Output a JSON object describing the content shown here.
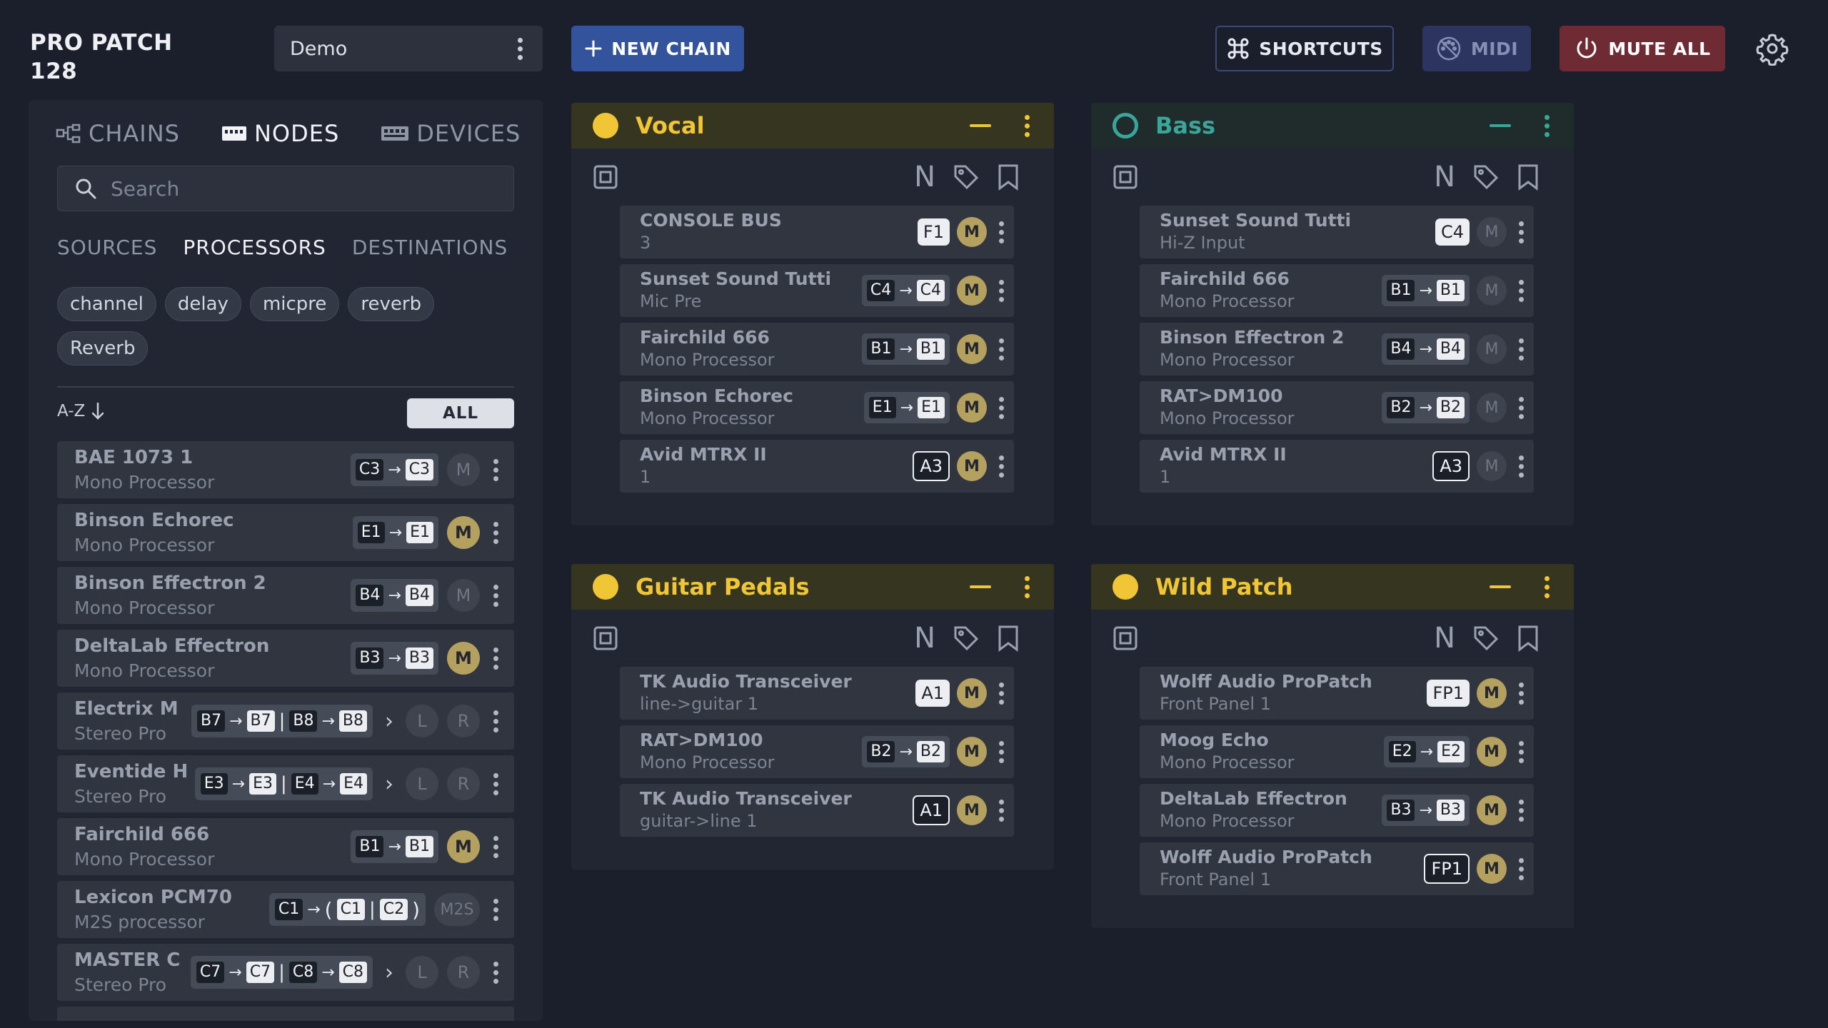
{
  "header": {
    "app_title_line1": "PRO PATCH",
    "app_title_line2": "128",
    "patch_name": "Demo",
    "new_chain_label": "NEW CHAIN",
    "shortcuts_label": "SHORTCUTS",
    "midi_label": "MIDI",
    "mute_all_label": "MUTE ALL"
  },
  "sidebar": {
    "tabs": [
      {
        "label": "CHAINS",
        "icon": "chains-icon"
      },
      {
        "label": "NODES",
        "icon": "nodes-icon",
        "active": true
      },
      {
        "label": "DEVICES",
        "icon": "devices-icon"
      }
    ],
    "search_placeholder": "Search",
    "subtabs": [
      "SOURCES",
      "PROCESSORS",
      "DESTINATIONS"
    ],
    "active_subtab": "PROCESSORS",
    "tags": [
      "channel",
      "delay",
      "micpre",
      "reverb",
      "Reverb"
    ],
    "sort_label": "A-Z",
    "all_label": "ALL",
    "nodes": [
      {
        "name": "BAE 1073 1",
        "sub": "Mono Processor",
        "in": "C3",
        "out": "C3",
        "btn": "M"
      },
      {
        "name": "Binson Echorec",
        "sub": "Mono Processor",
        "in": "E1",
        "out": "E1",
        "btn": "M"
      },
      {
        "name": "Binson Effectron 2",
        "sub": "Mono Processor",
        "in": "B4",
        "out": "B4",
        "btn": "M"
      },
      {
        "name": "DeltaLab Effectron",
        "sub": "Mono Processor",
        "in": "B3",
        "out": "B3",
        "btn": "M"
      },
      {
        "name": "Electrix M",
        "sub": "Stereo Pro",
        "in1": "B7",
        "out1": "B7",
        "in2": "B8",
        "out2": "B8",
        "l": "L",
        "r": "R"
      },
      {
        "name": "Eventide H",
        "sub": "Stereo Pro",
        "in1": "E3",
        "out1": "E3",
        "in2": "E4",
        "out2": "E4",
        "l": "L",
        "r": "R"
      },
      {
        "name": "Fairchild 666",
        "sub": "Mono Processor",
        "in": "B1",
        "out": "B1",
        "btn": "M"
      },
      {
        "name": "Lexicon PCM70",
        "sub": "M2S processor",
        "in": "C1",
        "out1": "C1",
        "out2": "C2",
        "btn": "M2S"
      },
      {
        "name": "MASTER C",
        "sub": "Stereo Pro",
        "in1": "C7",
        "out1": "C7",
        "in2": "C8",
        "out2": "C8",
        "l": "L",
        "r": "R"
      }
    ]
  },
  "chains": [
    {
      "title": "Vocal",
      "n_letter": "N",
      "nodes": [
        {
          "name": "CONSOLE BUS",
          "sub": "3",
          "port": "F1",
          "btn": "M"
        },
        {
          "name": "Sunset Sound Tutti",
          "sub": "Mic Pre",
          "in": "C4",
          "out": "C4",
          "btn": "M"
        },
        {
          "name": "Fairchild 666",
          "sub": "Mono Processor",
          "in": "B1",
          "out": "B1",
          "btn": "M"
        },
        {
          "name": "Binson Echorec",
          "sub": "Mono Processor",
          "in": "E1",
          "out": "E1",
          "btn": "M"
        },
        {
          "name": "Avid MTRX II",
          "sub": "1",
          "port": "A3",
          "btn": "M"
        }
      ]
    },
    {
      "title": "Bass",
      "n_letter": "N",
      "nodes": [
        {
          "name": "Sunset Sound Tutti",
          "sub": "Hi-Z Input",
          "port": "C4",
          "btn": "M"
        },
        {
          "name": "Fairchild 666",
          "sub": "Mono Processor",
          "in": "B1",
          "out": "B1",
          "btn": "M"
        },
        {
          "name": "Binson Effectron 2",
          "sub": "Mono Processor",
          "in": "B4",
          "out": "B4",
          "btn": "M"
        },
        {
          "name": "RAT>DM100",
          "sub": "Mono Processor",
          "in": "B2",
          "out": "B2",
          "btn": "M"
        },
        {
          "name": "Avid MTRX II",
          "sub": "1",
          "port": "A3",
          "btn": "M"
        }
      ]
    },
    {
      "title": "Guitar Pedals",
      "n_letter": "N",
      "nodes": [
        {
          "name": "TK Audio Transceiver",
          "sub": "line->guitar 1",
          "port": "A1",
          "btn": "M"
        },
        {
          "name": "RAT>DM100",
          "sub": "Mono Processor",
          "in": "B2",
          "out": "B2",
          "btn": "M"
        },
        {
          "name": "TK Audio Transceiver",
          "sub": "guitar->line 1",
          "port": "A1",
          "btn": "M"
        }
      ]
    },
    {
      "title": "Wild Patch",
      "n_letter": "N",
      "nodes": [
        {
          "name": "Wolff Audio ProPatch",
          "sub": "Front Panel 1",
          "port": "FP1",
          "btn": "M"
        },
        {
          "name": "Moog Echo",
          "sub": "Mono Processor",
          "in": "E2",
          "out": "E2",
          "btn": "M"
        },
        {
          "name": "DeltaLab Effectron",
          "sub": "Mono Processor",
          "in": "B3",
          "out": "B3",
          "btn": "M"
        },
        {
          "name": "Wolff Audio ProPatch",
          "sub": "Front Panel 1",
          "port": "FP1",
          "btn": "M"
        }
      ]
    }
  ],
  "colors": {
    "background": "#1b1f2c",
    "panel": "#222633",
    "accent_blue": "#33539c",
    "mute_red": "#6e2b34",
    "chain_yellow": "#f0c637",
    "chain_teal": "#3aa69a",
    "mute_active": "#b4a05f"
  }
}
